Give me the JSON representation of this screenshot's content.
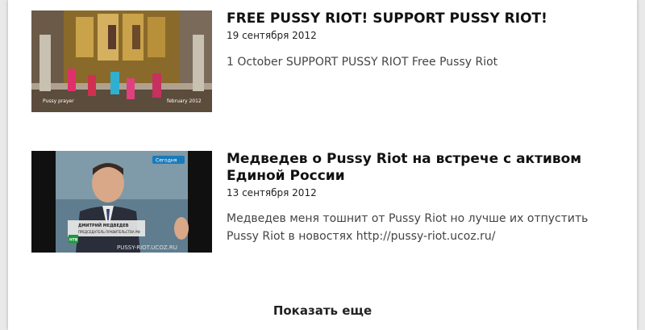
{
  "posts": [
    {
      "title": "FREE PUSSY RIOT! SUPPORT PUSSY RIOT!",
      "date": "19 сентября 2012",
      "description": "1 October SUPPORT PUSSY RIOT Free Pussy Riot",
      "thumb_caption_left": "Pussy prayer",
      "thumb_caption_right": "february 2012"
    },
    {
      "title": "Медведев о Pussy Riot на встрече с активом Единой России",
      "date": "13 сентября 2012",
      "description": "Медведев меня тошнит от Pussy Riot но лучше их отпустить Pussy Riot в новостях http://pussy-riot.ucoz.ru/",
      "thumb_watermark": "PUSSY-RIOT.UCOZ.RU",
      "thumb_channel": "НТВ",
      "thumb_lower_third": "ДМИТРИЙ МЕДВЕДЕВ",
      "thumb_lower_third_sub": "ПРЕДСЕДАТЕЛЬ ПРАВИТЕЛЬСТВА РФ",
      "thumb_badge": "Сегодня"
    }
  ],
  "load_more_label": "Показать еще"
}
